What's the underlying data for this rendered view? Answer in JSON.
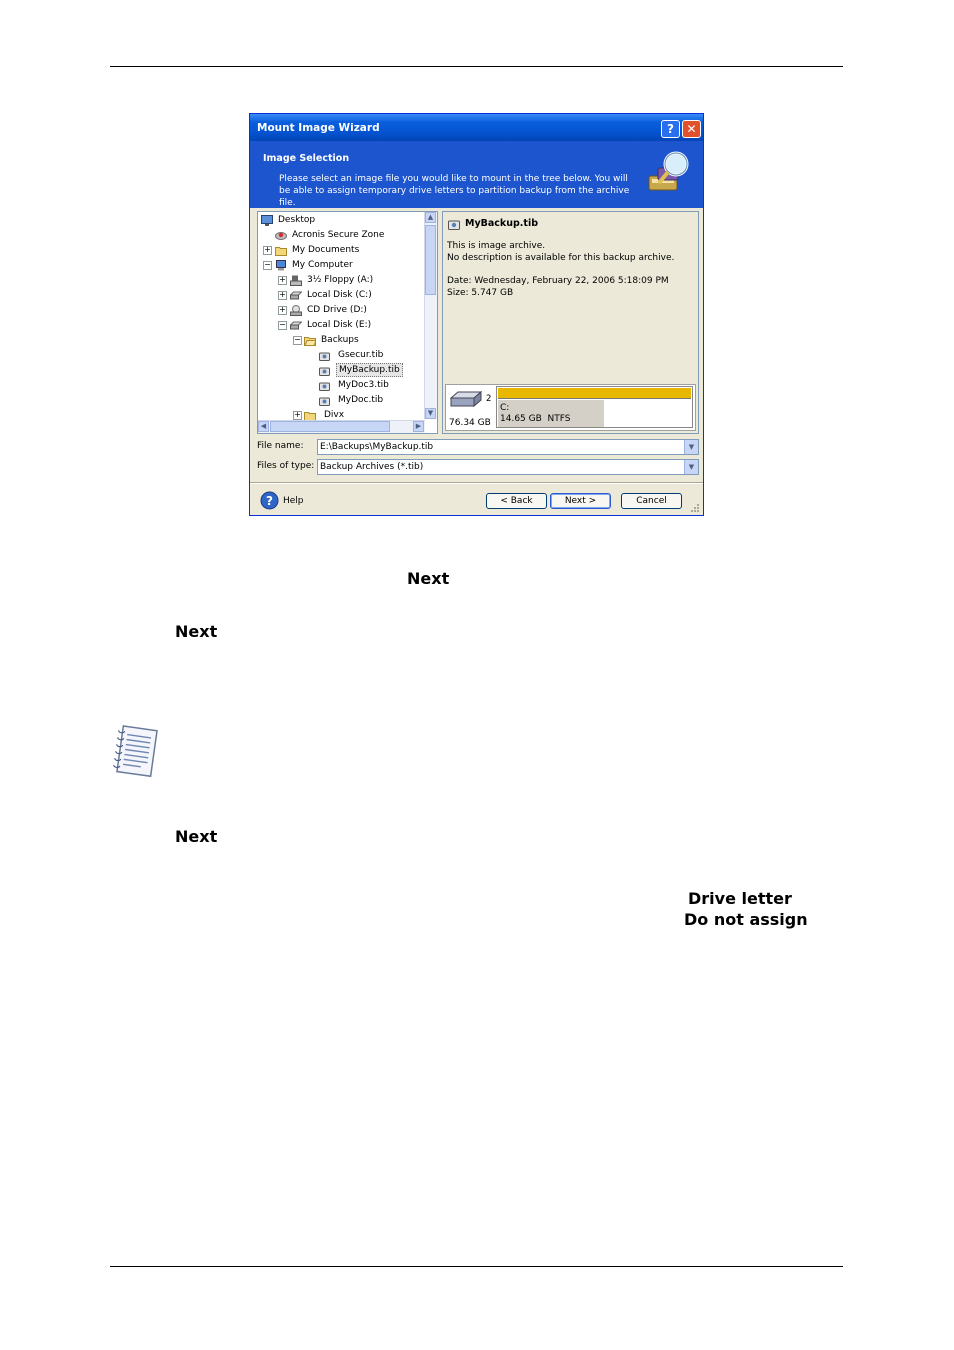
{
  "dialog": {
    "title": "Mount Image Wizard",
    "help_glyph": "?",
    "close_glyph": "✕",
    "header_title": "Image Selection",
    "header_description": "Please select an image file you would like to mount in the tree below. You will be able to assign temporary drive letters to partition backup from the archive file.",
    "tree": [
      {
        "label": "Desktop",
        "icon": "desktop-icon"
      },
      {
        "label": "Acronis Secure Zone",
        "icon": "secure-zone-icon"
      },
      {
        "label": "My Documents",
        "icon": "folder-icon",
        "expander": "+"
      },
      {
        "label": "My Computer",
        "icon": "computer-icon",
        "expander": "−"
      },
      {
        "label": "3½ Floppy (A:)",
        "icon": "floppy-icon",
        "expander": "+"
      },
      {
        "label": "Local Disk (C:)",
        "icon": "disk-icon",
        "expander": "+"
      },
      {
        "label": "CD Drive (D:)",
        "icon": "cd-icon",
        "expander": "+"
      },
      {
        "label": "Local Disk (E:)",
        "icon": "disk-icon",
        "expander": "−"
      },
      {
        "label": "Backups",
        "icon": "folder-open-icon",
        "expander": "−"
      },
      {
        "label": "Gsecur.tib",
        "icon": "archive-icon"
      },
      {
        "label": "MyBackup.tib",
        "icon": "archive-icon",
        "selected": true
      },
      {
        "label": "MyDoc3.tib",
        "icon": "archive-icon"
      },
      {
        "label": "MyDoc.tib",
        "icon": "archive-icon"
      },
      {
        "label": "Divx",
        "icon": "folder-icon",
        "expander": "+"
      }
    ],
    "info": {
      "file_name": "MyBackup.tib",
      "line1": "This is image archive.",
      "line2": "No description is available for this backup archive.",
      "date": "Date: Wednesday, February 22, 2006 5:18:09 PM",
      "size": "Size: 5.747 GB",
      "disk_number": "2",
      "disk_size": "76.34 GB",
      "partition_letter": "C:",
      "partition_info": "14.65 GB  NTFS",
      "partition_color": "#e8b800"
    },
    "file_name_label": "File name:",
    "file_name_value": "E:\\Backups\\MyBackup.tib",
    "files_of_type_label": "Files of type:",
    "files_of_type_value": "Backup Archives (*.tib)",
    "help_label": "Help",
    "back_label": "< Back",
    "next_label": "Next >",
    "cancel_label": "Cancel"
  },
  "doc": {
    "next1": "Next",
    "next2": "Next",
    "next3": "Next",
    "drive_letter": "Drive letter",
    "do_not_assign": "Do not assign"
  }
}
